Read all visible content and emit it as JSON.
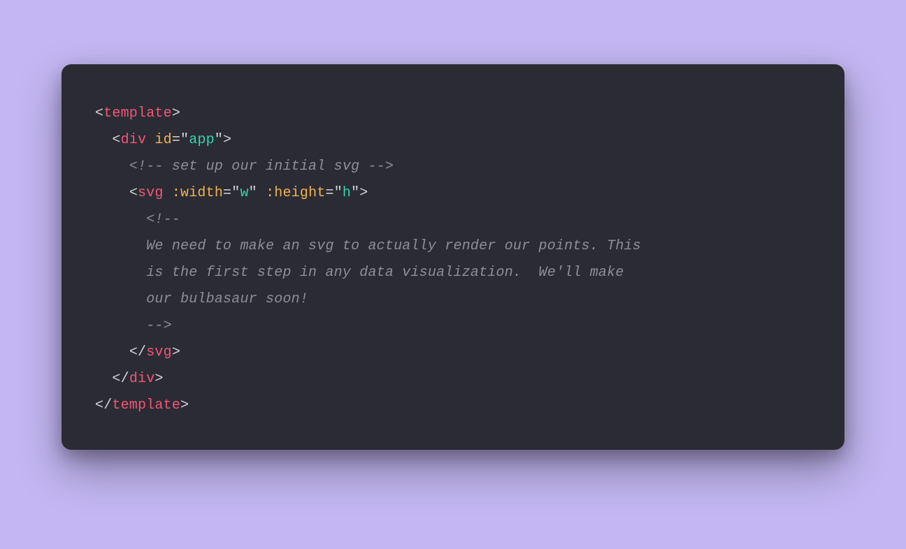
{
  "colors": {
    "page_bg": "#c3b6f2",
    "card_bg": "#2b2c33",
    "punct": "#d6d7db",
    "tag": "#f0567a",
    "attr": "#f0b254",
    "string": "#2fd6b0",
    "comment": "#8d8f97"
  },
  "code": {
    "l1": {
      "open": "<",
      "tag": "template",
      "close": ">"
    },
    "l2": {
      "open": "<",
      "tag": "div",
      "sp": " ",
      "attr": "id",
      "eq": "=",
      "q1": "\"",
      "val": "app",
      "q2": "\"",
      "close": ">"
    },
    "l3": {
      "comment": "<!-- set up our initial svg -->"
    },
    "l4": {
      "open": "<",
      "tag": "svg",
      "sp1": " ",
      "attr1": ":width",
      "eq1": "=",
      "q1a": "\"",
      "val1": "w",
      "q1b": "\"",
      "sp2": " ",
      "attr2": ":height",
      "eq2": "=",
      "q2a": "\"",
      "val2": "h",
      "q2b": "\"",
      "close": ">"
    },
    "l5": {
      "comment": "<!--"
    },
    "l6": {
      "comment": "We need to make an svg to actually render our points. This"
    },
    "l7": {
      "comment": "is the first step in any data visualization.  We'll make"
    },
    "l8": {
      "comment": "our bulbasaur soon!"
    },
    "l9": {
      "comment": "-->"
    },
    "l10": {
      "open": "</",
      "tag": "svg",
      "close": ">"
    },
    "l11": {
      "open": "</",
      "tag": "div",
      "close": ">"
    },
    "l12": {
      "open": "</",
      "tag": "template",
      "close": ">"
    }
  }
}
